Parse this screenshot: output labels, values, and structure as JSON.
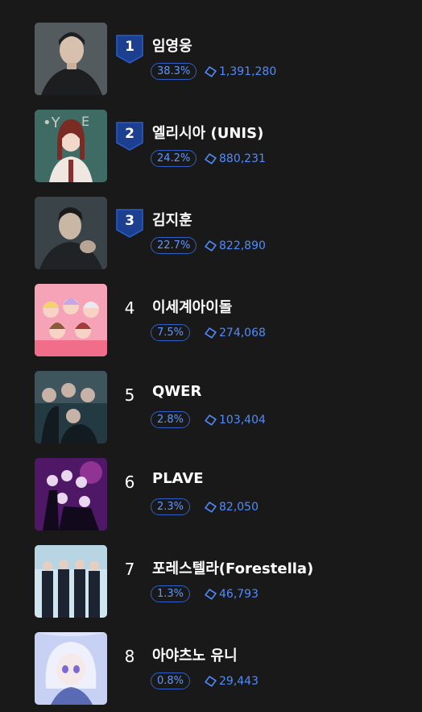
{
  "ranking": [
    {
      "rank": "1",
      "name": "임영웅",
      "percent": "38.3%",
      "votes": "1,391,280",
      "badge": true,
      "thumb_colors": [
        "#5b6366",
        "#2c3133",
        "#1c1e1f"
      ],
      "icon": "heart-outline-icon"
    },
    {
      "rank": "2",
      "name": "엘리시아 (UNIS)",
      "percent": "24.2%",
      "votes": "880,231",
      "badge": true,
      "thumb_colors": [
        "#3e6b63",
        "#8a2d2d",
        "#efe7e0"
      ],
      "icon": "heart-outline-icon"
    },
    {
      "rank": "3",
      "name": "김지훈",
      "percent": "22.7%",
      "votes": "822,890",
      "badge": true,
      "thumb_colors": [
        "#3a4448",
        "#1f2326",
        "#c9b7a6"
      ],
      "icon": "heart-outline-icon"
    },
    {
      "rank": "4",
      "name": "이세계아이돌",
      "percent": "7.5%",
      "votes": "274,068",
      "badge": false,
      "thumb_colors": [
        "#f6a3b7",
        "#f7d3c5",
        "#c5a6e8"
      ],
      "icon": "heart-outline-icon"
    },
    {
      "rank": "5",
      "name": "QWER",
      "percent": "2.8%",
      "votes": "103,404",
      "badge": false,
      "thumb_colors": [
        "#233a43",
        "#516770",
        "#121b1f"
      ],
      "icon": "heart-outline-icon"
    },
    {
      "rank": "6",
      "name": "PLAVE",
      "percent": "2.3%",
      "votes": "82,050",
      "badge": false,
      "thumb_colors": [
        "#6b1f87",
        "#2a1140",
        "#d24ec2"
      ],
      "icon": "heart-outline-icon"
    },
    {
      "rank": "7",
      "name": "포레스텔라(Forestella)",
      "percent": "1.3%",
      "votes": "46,793",
      "badge": false,
      "thumb_colors": [
        "#cfe6f0",
        "#1b2430",
        "#9fc3d3"
      ],
      "icon": "heart-outline-icon"
    },
    {
      "rank": "8",
      "name": "아야츠노 유니",
      "percent": "0.8%",
      "votes": "29,443",
      "badge": false,
      "thumb_colors": [
        "#dfe6fb",
        "#9aa9e6",
        "#2c3f9a"
      ],
      "icon": "heart-outline-icon"
    }
  ],
  "colors": {
    "background": "#191919",
    "badge": "#1d3f8f",
    "badge_border": "#2b5ec8",
    "accent": "#4f8cff",
    "pill_border": "#2f5fc4"
  }
}
